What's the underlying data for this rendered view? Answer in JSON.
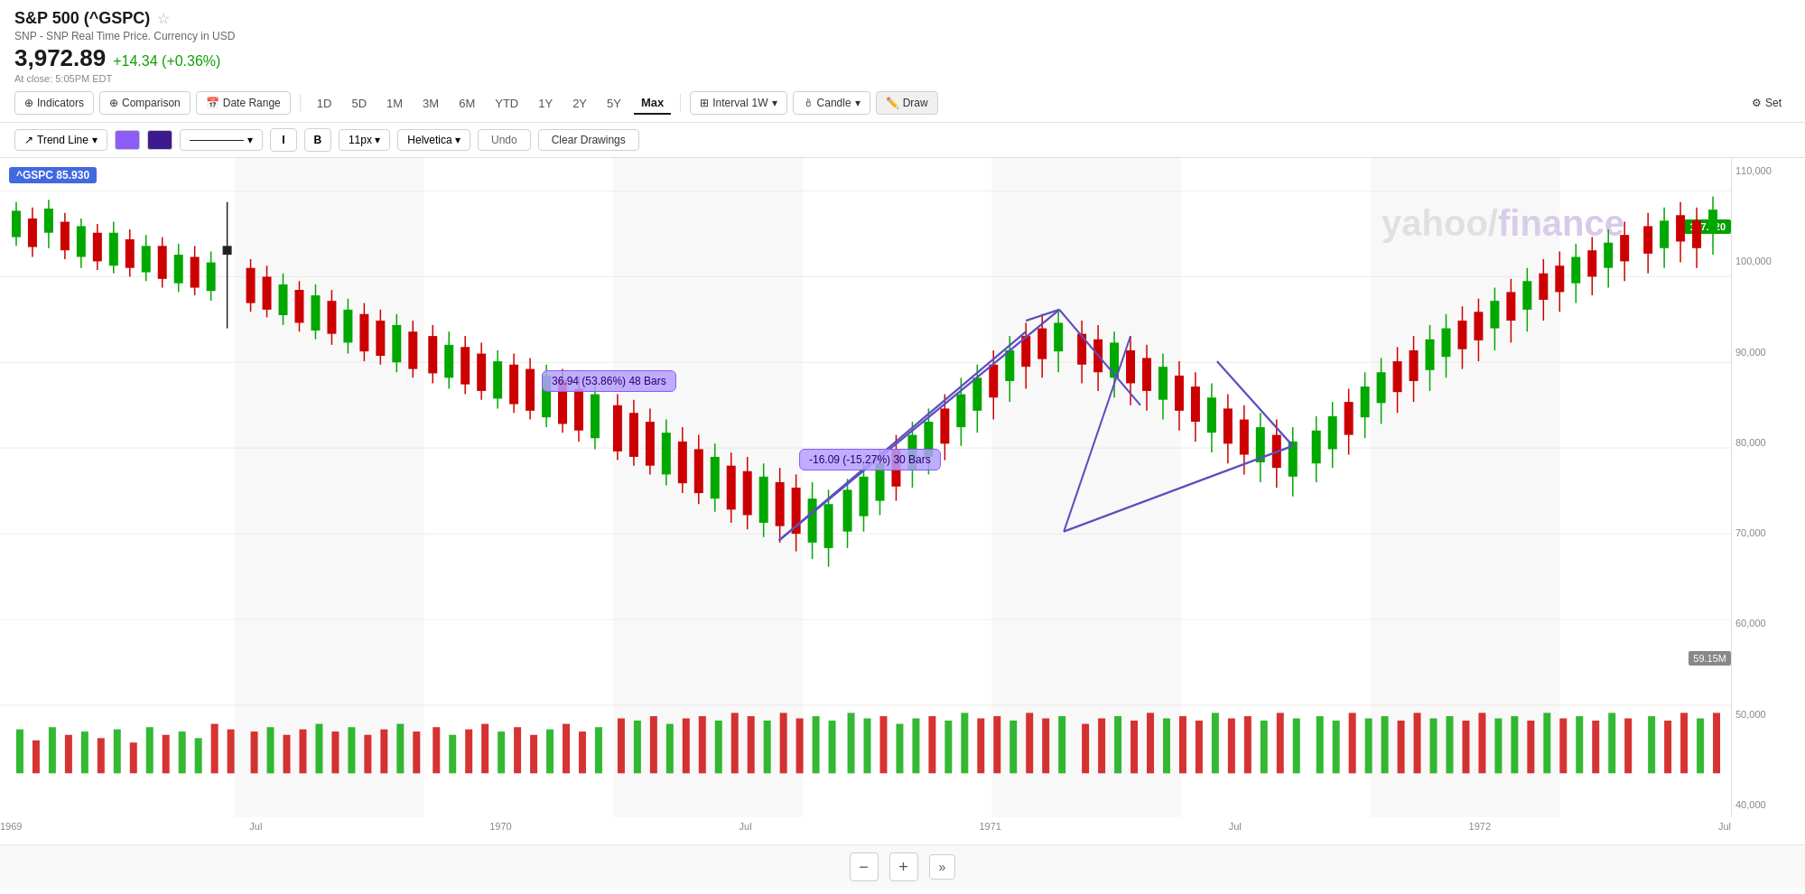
{
  "header": {
    "title": "S&P 500 (^GSPC)",
    "subtitle": "SNP - SNP Real Time Price. Currency in USD",
    "price": "3,972.89",
    "change": "+14.34 (+0.36%)",
    "close_time": "At close: 5:05PM EDT"
  },
  "toolbar": {
    "indicators_label": "Indicators",
    "comparison_label": "Comparison",
    "date_range_label": "Date Range",
    "periods": [
      "1D",
      "5D",
      "1M",
      "3M",
      "6M",
      "YTD",
      "1Y",
      "2Y",
      "5Y",
      "Max"
    ],
    "active_period": "Max",
    "interval_label": "Interval",
    "interval_value": "1W",
    "candle_label": "Candle",
    "draw_label": "Draw",
    "settings_label": "Set"
  },
  "drawing_toolbar": {
    "trend_line_label": "Trend Line",
    "line_style_label": "—————",
    "italic_label": "I",
    "bold_label": "B",
    "font_size_label": "11px",
    "font_family_label": "Helvetica",
    "undo_label": "Undo",
    "clear_label": "Clear Drawings"
  },
  "chart": {
    "price_label": "^GSPC  85.930",
    "current_price": "107.920",
    "volume_label": "59.15M",
    "watermark_text": "yahoo/finance",
    "y_axis_labels": [
      "110,000",
      "100,000",
      "90,000",
      "80,000",
      "70,000",
      "60,000",
      "50,000",
      "40,000"
    ],
    "x_axis_labels": [
      "1969",
      "Jul",
      "1970",
      "Jul",
      "1971",
      "Jul",
      "1972",
      "Jul"
    ]
  },
  "annotations": [
    {
      "text": "36.94 (53.86%) 48 Bars",
      "top": "245",
      "left": "620"
    },
    {
      "text": "-16.09 (-15.27%) 30 Bars",
      "top": "332",
      "left": "920"
    }
  ],
  "bottom_controls": {
    "zoom_in_label": "+",
    "zoom_out_label": "−",
    "expand_label": "»"
  }
}
